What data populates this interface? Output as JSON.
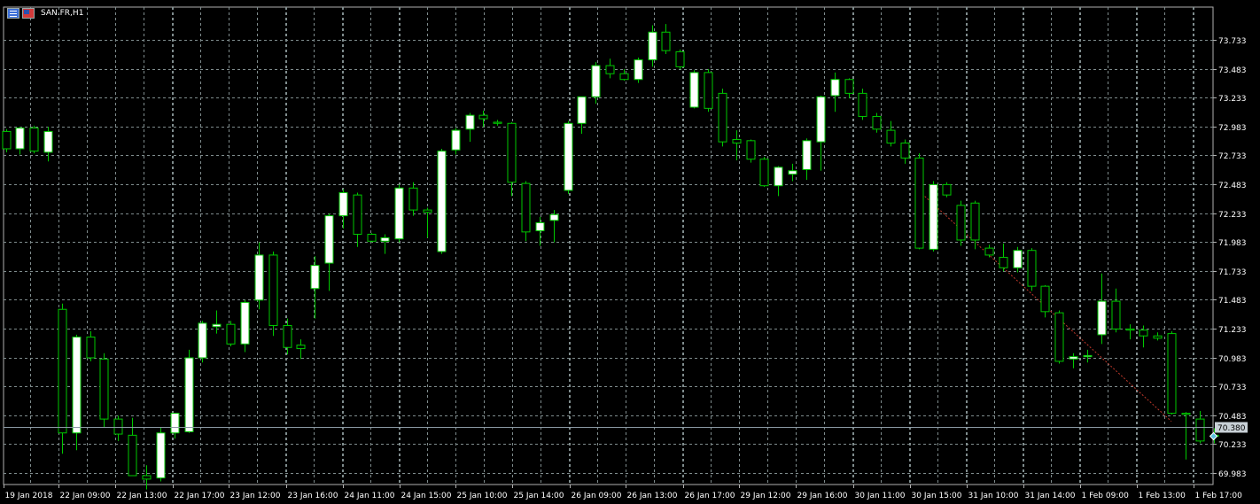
{
  "header": {
    "symbol_title": "SAN.FR,H1",
    "icons": [
      "chart-window-icon",
      "flag-icon"
    ]
  },
  "colors": {
    "background": "#000000",
    "grid": "#7f8c8d",
    "bull": "#ffffff",
    "bear": "#000000",
    "wick": "#00c800",
    "price_line": "#8c9aa5",
    "trend": "#c0392b",
    "text": "#ffffff"
  },
  "chart_data": {
    "type": "candlestick",
    "symbol": "SAN.FR",
    "timeframe": "H1",
    "grid": true,
    "ylim": [
      69.85,
      73.9
    ],
    "y_ticks": [
      "73.733",
      "73.483",
      "73.233",
      "72.983",
      "72.733",
      "72.483",
      "72.233",
      "71.983",
      "71.733",
      "71.483",
      "71.233",
      "70.983",
      "70.733",
      "70.483",
      "70.233",
      "69.983"
    ],
    "x_labels": [
      "19 Jan 2018",
      "22 Jan 09:00",
      "22 Jan 13:00",
      "22 Jan 17:00",
      "23 Jan 12:00",
      "23 Jan 16:00",
      "24 Jan 11:00",
      "24 Jan 15:00",
      "25 Jan 10:00",
      "25 Jan 14:00",
      "26 Jan 09:00",
      "26 Jan 13:00",
      "26 Jan 17:00",
      "29 Jan 12:00",
      "29 Jan 16:00",
      "30 Jan 11:00",
      "30 Jan 15:00",
      "31 Jan 10:00",
      "31 Jan 14:00",
      "1 Feb 09:00",
      "1 Feb 13:00",
      "1 Feb 17:00"
    ],
    "current_price": "70.380",
    "current_price_value": 70.38,
    "trend_line": {
      "from": {
        "bar": 65,
        "value": 72.42
      },
      "to": {
        "bar": 83,
        "value": 70.43
      }
    },
    "candles": [
      [
        72.94,
        72.96,
        72.76,
        72.79
      ],
      [
        72.79,
        72.98,
        72.74,
        72.97
      ],
      [
        72.97,
        72.99,
        72.75,
        72.77
      ],
      [
        72.76,
        72.98,
        72.68,
        72.94
      ],
      [
        71.4,
        71.45,
        70.15,
        70.33
      ],
      [
        70.33,
        71.18,
        70.18,
        71.16
      ],
      [
        71.16,
        71.21,
        70.95,
        70.98
      ],
      [
        70.97,
        71.02,
        70.38,
        70.45
      ],
      [
        70.45,
        70.48,
        70.26,
        70.32
      ],
      [
        70.31,
        70.46,
        70.01,
        69.96
      ],
      [
        69.96,
        70.05,
        69.84,
        69.93
      ],
      [
        69.94,
        70.38,
        69.91,
        70.33
      ],
      [
        70.33,
        70.49,
        70.28,
        70.5
      ],
      [
        70.34,
        71.05,
        70.33,
        70.98
      ],
      [
        70.98,
        71.3,
        70.94,
        71.28
      ],
      [
        71.25,
        71.39,
        71.19,
        71.27
      ],
      [
        71.27,
        71.3,
        71.08,
        71.1
      ],
      [
        71.1,
        71.48,
        71.03,
        71.46
      ],
      [
        71.48,
        71.98,
        71.4,
        71.87
      ],
      [
        71.87,
        71.9,
        71.17,
        71.26
      ],
      [
        71.26,
        71.32,
        71.01,
        71.07
      ],
      [
        71.09,
        71.14,
        70.97,
        71.06
      ],
      [
        71.58,
        71.86,
        71.32,
        71.78
      ],
      [
        71.8,
        72.23,
        71.56,
        72.21
      ],
      [
        72.21,
        72.44,
        72.1,
        72.41
      ],
      [
        72.39,
        72.41,
        71.94,
        72.05
      ],
      [
        72.05,
        72.06,
        71.98,
        71.99
      ],
      [
        71.99,
        72.05,
        71.88,
        72.02
      ],
      [
        72.01,
        72.48,
        71.98,
        72.45
      ],
      [
        72.45,
        72.5,
        72.21,
        72.26
      ],
      [
        72.26,
        72.28,
        72.02,
        72.24
      ],
      [
        71.9,
        72.79,
        71.88,
        72.77
      ],
      [
        72.78,
        72.97,
        72.74,
        72.95
      ],
      [
        72.96,
        73.1,
        72.85,
        73.08
      ],
      [
        73.08,
        73.12,
        72.98,
        73.05
      ],
      [
        73.02,
        73.04,
        72.99,
        73.01
      ],
      [
        73.01,
        73.02,
        72.38,
        72.5
      ],
      [
        72.49,
        72.51,
        71.99,
        72.07
      ],
      [
        72.08,
        72.2,
        71.95,
        72.15
      ],
      [
        72.17,
        72.26,
        71.98,
        72.22
      ],
      [
        72.43,
        73.03,
        72.4,
        73.01
      ],
      [
        73.01,
        73.23,
        72.92,
        73.24
      ],
      [
        73.24,
        73.54,
        73.18,
        73.51
      ],
      [
        73.51,
        73.57,
        73.4,
        73.44
      ],
      [
        73.44,
        73.48,
        73.38,
        73.39
      ],
      [
        73.39,
        73.58,
        73.36,
        73.56
      ],
      [
        73.56,
        73.86,
        73.5,
        73.8
      ],
      [
        73.8,
        73.87,
        73.61,
        73.64
      ],
      [
        73.63,
        73.65,
        73.48,
        73.5
      ],
      [
        73.15,
        73.47,
        73.14,
        73.45
      ],
      [
        73.45,
        73.48,
        73.11,
        73.14
      ],
      [
        73.27,
        73.31,
        72.81,
        72.85
      ],
      [
        72.87,
        72.95,
        72.69,
        72.84
      ],
      [
        72.86,
        72.87,
        72.67,
        72.7
      ],
      [
        72.7,
        72.72,
        72.46,
        72.47
      ],
      [
        72.47,
        72.64,
        72.38,
        72.63
      ],
      [
        72.57,
        72.66,
        72.51,
        72.6
      ],
      [
        72.61,
        72.88,
        72.52,
        72.86
      ],
      [
        72.85,
        73.25,
        72.6,
        73.24
      ],
      [
        73.25,
        73.45,
        73.11,
        73.39
      ],
      [
        73.39,
        73.4,
        73.23,
        73.27
      ],
      [
        73.27,
        73.31,
        73.04,
        73.07
      ],
      [
        73.07,
        73.1,
        72.93,
        72.96
      ],
      [
        72.95,
        73.03,
        72.81,
        72.84
      ],
      [
        72.84,
        72.87,
        72.66,
        72.71
      ],
      [
        72.71,
        72.75,
        71.92,
        71.93
      ],
      [
        71.92,
        72.51,
        71.9,
        72.48
      ],
      [
        72.48,
        72.5,
        72.37,
        72.39
      ],
      [
        72.3,
        72.34,
        71.95,
        72.0
      ],
      [
        72.32,
        72.34,
        71.92,
        72.0
      ],
      [
        71.93,
        71.96,
        71.85,
        71.87
      ],
      [
        71.85,
        71.97,
        71.73,
        71.76
      ],
      [
        71.76,
        71.94,
        71.72,
        71.91
      ],
      [
        71.91,
        71.93,
        71.56,
        71.6
      ],
      [
        71.6,
        71.61,
        71.33,
        71.38
      ],
      [
        71.37,
        71.39,
        70.93,
        70.95
      ],
      [
        70.97,
        71.02,
        70.89,
        70.99
      ],
      [
        70.99,
        71.05,
        70.94,
        71.0
      ],
      [
        71.18,
        71.71,
        71.1,
        71.47
      ],
      [
        71.47,
        71.58,
        71.2,
        71.23
      ],
      [
        71.23,
        71.27,
        71.14,
        71.22
      ],
      [
        71.22,
        71.26,
        71.07,
        71.17
      ],
      [
        71.17,
        71.2,
        71.13,
        71.15
      ],
      [
        71.19,
        71.21,
        70.49,
        70.5
      ],
      [
        70.5,
        70.51,
        70.1,
        70.49
      ],
      [
        70.45,
        70.52,
        70.24,
        70.26
      ],
      [
        70.31,
        70.37,
        70.24,
        70.3
      ]
    ]
  }
}
